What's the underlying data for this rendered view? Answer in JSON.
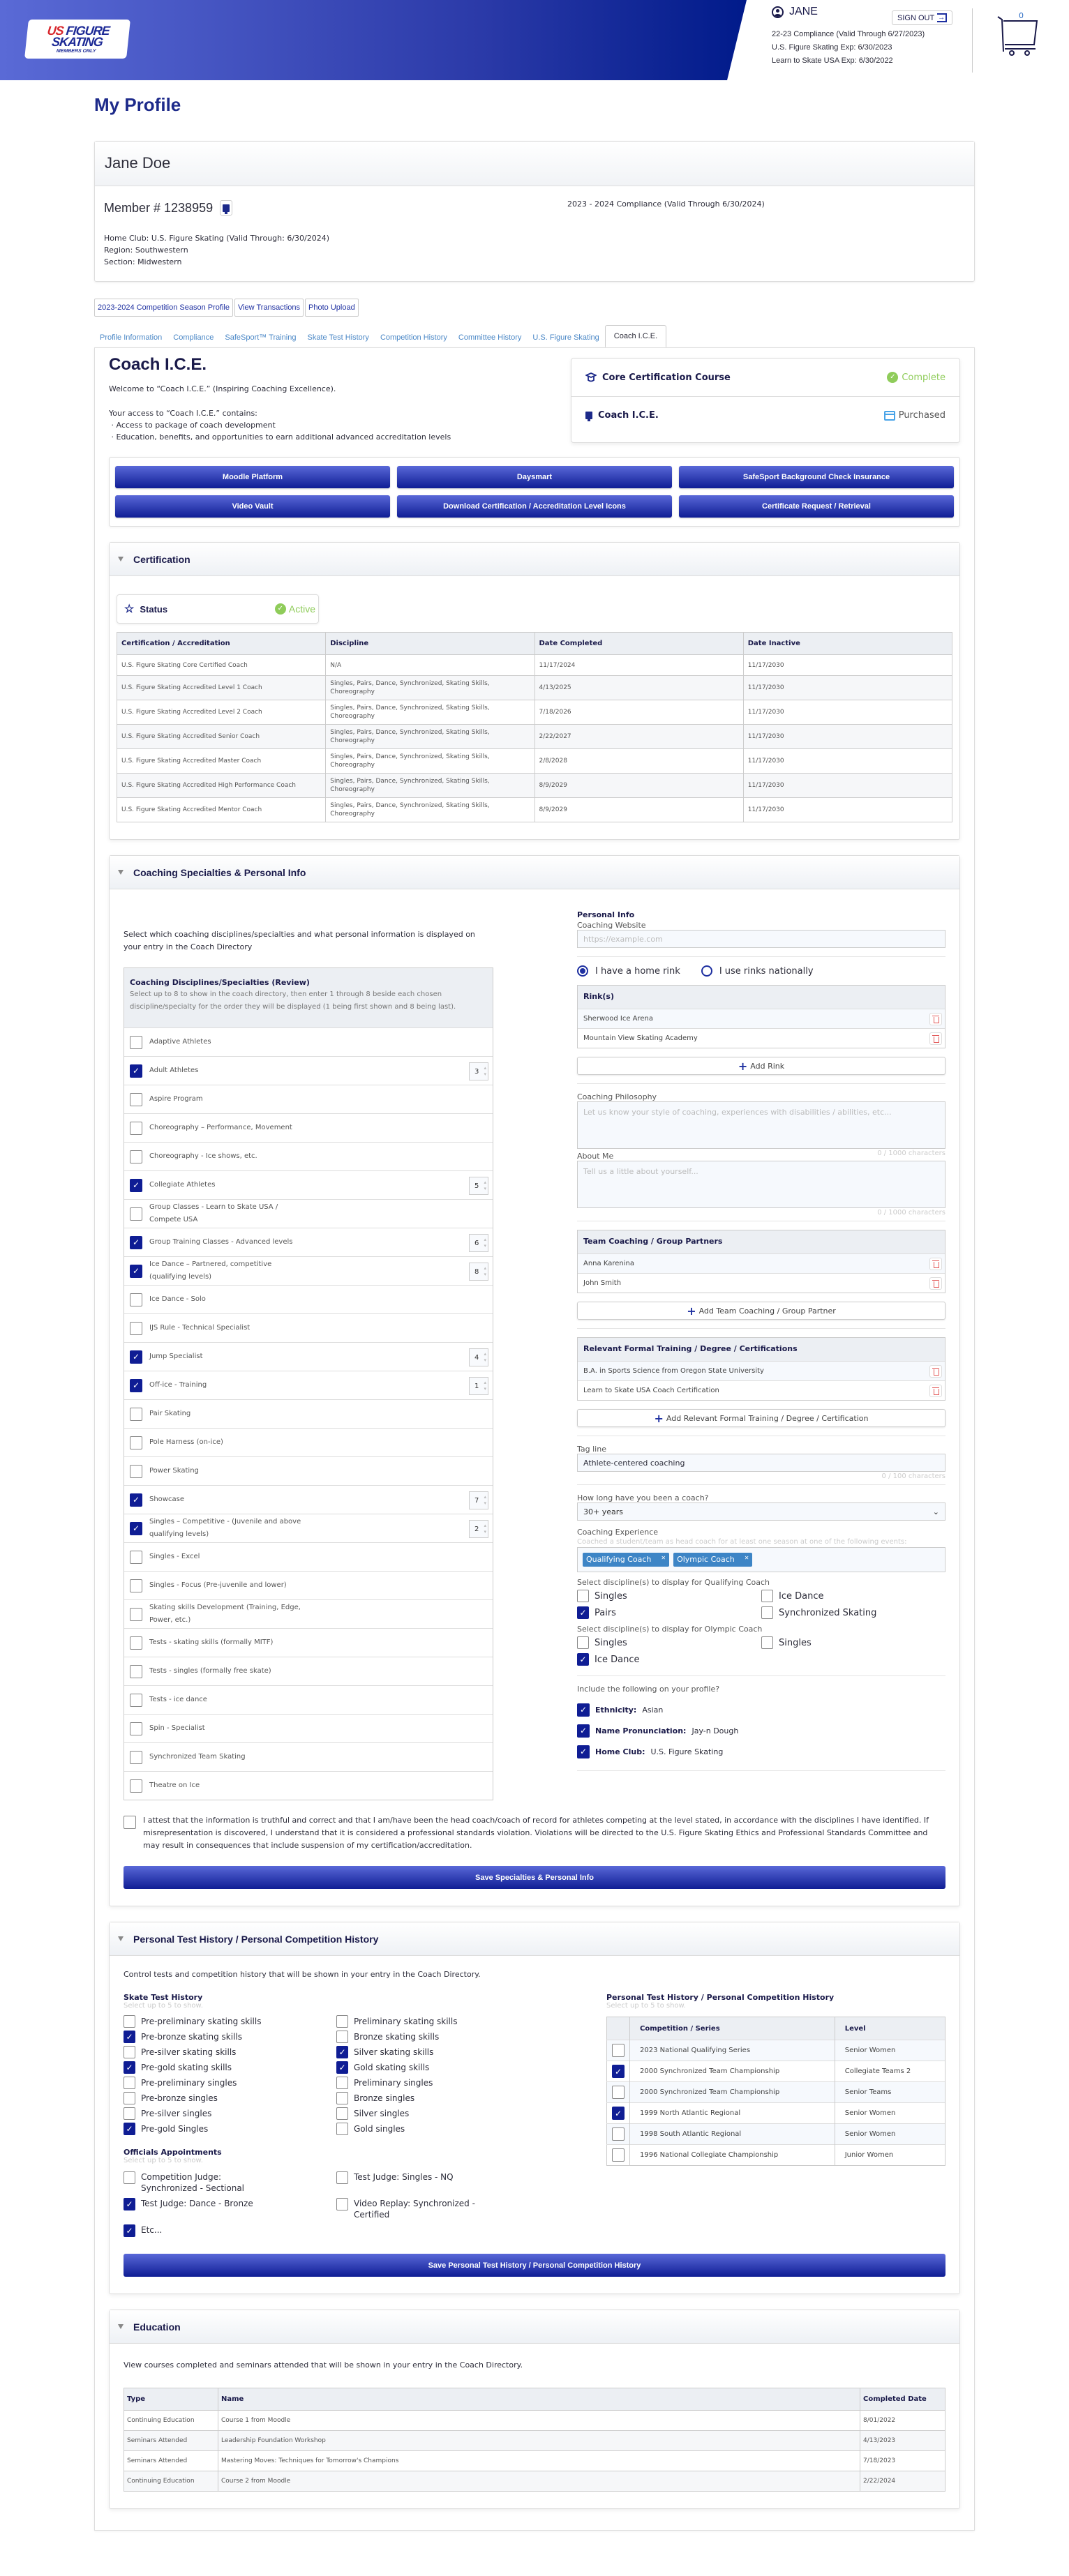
{
  "header": {
    "logo": {
      "line1a": "US",
      "line1b": "FIGURE",
      "line2": "SKATING",
      "line3": "MEMBERS ONLY"
    },
    "user_name": "JANE",
    "sign_out_label": "SIGN OUT",
    "status_lines": [
      "22-23 Compliance (Valid Through 6/27/2023)",
      "U.S. Figure Skating Exp: 6/30/2023",
      "Learn to Skate USA Exp: 6/30/2022"
    ],
    "cart_count": "0"
  },
  "page_title": "My Profile",
  "profile": {
    "name": "Jane Doe",
    "member_number": "Member # 1238959",
    "compliance": "2023 - 2024 Compliance (Valid Through 6/30/2024)",
    "home_club": "Home Club: U.S. Figure Skating (Valid Through: 6/30/2024)",
    "region": "Region:  Southwestern",
    "section": "Section:  Midwestern"
  },
  "link_buttons": [
    "2023-2024 Competition Season Profile",
    "View Transactions",
    "Photo Upload"
  ],
  "tabs": [
    {
      "label": "Profile Information",
      "active": false
    },
    {
      "label": "Compliance",
      "active": false
    },
    {
      "label": "SafeSport™ Training",
      "active": false
    },
    {
      "label": "Skate Test History",
      "active": false
    },
    {
      "label": "Competition History",
      "active": false
    },
    {
      "label": "Committee History",
      "active": false
    },
    {
      "label": "U.S. Figure Skating",
      "active": false
    },
    {
      "label": "Coach I.C.E.",
      "active": true
    }
  ],
  "coach_ice": {
    "title": "Coach I.C.E.",
    "welcome": "Welcome to “Coach I.C.E.” (Inspiring Coaching Excellence).",
    "access_intro": "Your access to “Coach I.C.E.” contains:",
    "bullets": [
      "Access to package of coach development",
      "Education, benefits, and opportunities to earn additional advanced accreditation levels"
    ],
    "status_card": [
      {
        "label": "Core Certification Course",
        "status": "Complete",
        "icon": "graduation-cap-icon"
      },
      {
        "label": "Coach I.C.E.",
        "status": "Purchased",
        "icon": "certificate-icon"
      }
    ],
    "buttons": [
      "Moodle Platform",
      "Daysmart",
      "SafeSport Background Check Insurance",
      "Video Vault",
      "Download Certification / Accreditation Level Icons",
      "Certificate Request / Retrieval"
    ]
  },
  "certification": {
    "title": "Certification",
    "status_label": "Status",
    "status_value": "Active",
    "columns": [
      "Certification / Accreditation",
      "Discipline",
      "Date Completed",
      "Date Inactive"
    ],
    "rows": [
      [
        "U.S. Figure Skating Core Certified Coach",
        "N/A",
        "11/17/2024",
        "11/17/2030"
      ],
      [
        "U.S. Figure Skating Accredited Level 1 Coach",
        "Singles, Pairs, Dance, Synchronized, Skating Skills, Choreography",
        "4/13/2025",
        "11/17/2030"
      ],
      [
        "U.S. Figure Skating Accredited Level 2 Coach",
        "Singles, Pairs, Dance, Synchronized, Skating Skills, Choreography",
        "7/18/2026",
        "11/17/2030"
      ],
      [
        "U.S. Figure Skating Accredited Senior Coach",
        "Singles, Pairs, Dance, Synchronized, Skating Skills, Choreography",
        "2/22/2027",
        "11/17/2030"
      ],
      [
        "U.S. Figure Skating Accredited Master Coach",
        "Singles, Pairs, Dance, Synchronized, Skating Skills, Choreography",
        "2/8/2028",
        "11/17/2030"
      ],
      [
        "U.S. Figure Skating Accredited High Performance Coach",
        "Singles, Pairs, Dance, Synchronized, Skating Skills, Choreography",
        "8/9/2029",
        "11/17/2030"
      ],
      [
        "U.S. Figure Skating Accredited Mentor Coach",
        "Singles, Pairs, Dance, Synchronized, Skating Skills, Choreography",
        "8/9/2029",
        "11/17/2030"
      ]
    ]
  },
  "specialties": {
    "title": "Coaching Specialties & Personal Info",
    "intro": "Select which coaching disciplines/specialties and what personal information is displayed on your entry in the Coach Directory",
    "disc_title": "Coaching Disciplines/Specialties (Review)",
    "disc_hint": "Select up to 8 to show in the coach directory, then enter 1 through 8 beside each chosen discipline/specialty for the order they will be displayed (1 being first shown and 8 being last).",
    "items": [
      {
        "label": "Adaptive Athletes",
        "checked": false,
        "order": ""
      },
      {
        "label": "Adult Athletes",
        "checked": true,
        "order": "3"
      },
      {
        "label": "Aspire Program",
        "checked": false,
        "order": ""
      },
      {
        "label": "Choreography – Performance, Movement",
        "checked": false,
        "order": ""
      },
      {
        "label": "Choreography - Ice shows, etc.",
        "checked": false,
        "order": ""
      },
      {
        "label": "Collegiate Athletes",
        "checked": true,
        "order": "5"
      },
      {
        "label": "Group Classes - Learn to Skate USA / Compete USA",
        "checked": false,
        "order": ""
      },
      {
        "label": "Group Training Classes - Advanced levels",
        "checked": true,
        "order": "6"
      },
      {
        "label": "Ice Dance – Partnered, competitive (qualifying levels)",
        "checked": true,
        "order": "8"
      },
      {
        "label": "Ice Dance - Solo",
        "checked": false,
        "order": ""
      },
      {
        "label": "IJS Rule - Technical Specialist",
        "checked": false,
        "order": ""
      },
      {
        "label": "Jump Specialist",
        "checked": true,
        "order": "4"
      },
      {
        "label": "Off-ice - Training",
        "checked": true,
        "order": "1"
      },
      {
        "label": "Pair Skating",
        "checked": false,
        "order": ""
      },
      {
        "label": "Pole Harness (on-ice)",
        "checked": false,
        "order": ""
      },
      {
        "label": "Power Skating",
        "checked": false,
        "order": ""
      },
      {
        "label": "Showcase",
        "checked": true,
        "order": "7"
      },
      {
        "label": "Singles – Competitive - (Juvenile and above qualifying levels)",
        "checked": true,
        "order": "2"
      },
      {
        "label": "Singles - Excel",
        "checked": false,
        "order": ""
      },
      {
        "label": "Singles - Focus (Pre-juvenile and lower)",
        "checked": false,
        "order": ""
      },
      {
        "label": "Skating skills Development (Training, Edge, Power, etc.)",
        "checked": false,
        "order": ""
      },
      {
        "label": "Tests - skating skills (formally MITF)",
        "checked": false,
        "order": ""
      },
      {
        "label": "Tests - singles (formally free skate)",
        "checked": false,
        "order": ""
      },
      {
        "label": "Tests - ice dance",
        "checked": false,
        "order": ""
      },
      {
        "label": "Spin - Specialist",
        "checked": false,
        "order": ""
      },
      {
        "label": "Synchronized Team Skating",
        "checked": false,
        "order": ""
      },
      {
        "label": "Theatre on Ice",
        "checked": false,
        "order": ""
      }
    ],
    "personal": {
      "title": "Personal Info",
      "website_label": "Coaching Website",
      "website_placeholder": "https://example.com",
      "radio_home": "I have a home rink",
      "radio_national": "I use rinks nationally",
      "rinks_title": "Rink(s)",
      "rinks": [
        "Sherwood Ice Arena",
        "Mountain View Skating Academy"
      ],
      "add_rink": "Add Rink",
      "philosophy_label": "Coaching Philosophy",
      "philosophy_placeholder": "Let us know your style of coaching, experiences with disabilities / abilities, etc...",
      "philosophy_counter": "0 / 1000 characters",
      "about_label": "About Me",
      "about_placeholder": "Tell us a little about yourself...",
      "about_counter": "0 / 1000 characters",
      "partners_title": "Team Coaching / Group Partners",
      "partners": [
        "Anna Karenina",
        "John Smith"
      ],
      "add_partner": "Add Team Coaching / Group Partner",
      "training_title": "Relevant Formal Training / Degree / Certifications",
      "training": [
        "B.A. in Sports Science from Oregon State University",
        "Learn to Skate USA Coach Certification"
      ],
      "add_training": "Add Relevant Formal Training / Degree / Certification",
      "tagline_label": "Tag line",
      "tagline_value": "Athlete-centered coaching",
      "tagline_counter": "0 / 100 characters",
      "years_label": "How long have you been a coach?",
      "years_value": "30+ years",
      "experience_label": "Coaching Experience",
      "experience_hint": "Coached a student/team as head coach for at least one season at one of the following events:",
      "experience_tags": [
        "Qualifying Coach",
        "Olympic Coach"
      ],
      "qual_label": "Select discipline(s) to display for Qualifying Coach",
      "qual_options": [
        {
          "label": "Singles",
          "checked": false
        },
        {
          "label": "Ice Dance",
          "checked": false
        },
        {
          "label": "Pairs",
          "checked": true
        },
        {
          "label": "Synchronized Skating",
          "checked": false
        }
      ],
      "olympic_label": "Select discipline(s) to display for Olympic Coach",
      "olympic_options": [
        {
          "label": "Singles",
          "checked": false
        },
        {
          "label": "Singles",
          "checked": false
        },
        {
          "label": "Ice Dance",
          "checked": true
        }
      ],
      "include_label": "Include the following on your profile?",
      "include": [
        {
          "key": "Ethnicity:",
          "value": "Asian",
          "checked": true
        },
        {
          "key": "Name Pronunciation:",
          "value": "Jay-n Dough",
          "checked": true
        },
        {
          "key": "Home Club:",
          "value": "U.S. Figure Skating",
          "checked": true
        }
      ]
    },
    "attest": "I attest that the information is truthful and correct and that I am/have been the head coach/coach of record for athletes competing at the level stated, in accordance with the disciplines I have identified. If misrepresentation is discovered, I understand that it is considered a professional standards violation. Violations will be directed to the U.S. Figure Skating Ethics and Professional Standards Committee and may result in consequences that include suspension of my certification/accreditation.",
    "save_label": "Save Specialties & Personal Info"
  },
  "history": {
    "title": "Personal Test History / Personal Competition History",
    "intro": "Control tests and competition history that will be shown in your entry in the Coach Directory.",
    "skate_title": "Skate Test History",
    "skate_hint": "Select up to 5 to show.",
    "skate_left": [
      {
        "label": "Pre-preliminary skating skills",
        "checked": false
      },
      {
        "label": "Pre-bronze skating skills",
        "checked": true
      },
      {
        "label": "Pre-silver skating skills",
        "checked": false
      },
      {
        "label": "Pre-gold skating skills",
        "checked": true
      },
      {
        "label": "Pre-preliminary singles",
        "checked": false
      },
      {
        "label": "Pre-bronze singles",
        "checked": false
      },
      {
        "label": "Pre-silver singles",
        "checked": false
      },
      {
        "label": "Pre-gold Singles",
        "checked": true
      }
    ],
    "skate_right": [
      {
        "label": "Preliminary skating skills",
        "checked": false
      },
      {
        "label": "Bronze skating skills",
        "checked": false
      },
      {
        "label": "Silver skating skills",
        "checked": true
      },
      {
        "label": "Gold skating skills",
        "checked": true
      },
      {
        "label": "Preliminary singles",
        "checked": false
      },
      {
        "label": "Bronze singles",
        "checked": false
      },
      {
        "label": "Silver singles",
        "checked": false
      },
      {
        "label": "Gold singles",
        "checked": false
      }
    ],
    "officials_title": "Officials Appointments",
    "officials_hint": "Select up to 5 to show.",
    "officials": [
      {
        "label": "Competition Judge: Synchronized - Sectional",
        "checked": false
      },
      {
        "label": "Test Judge: Singles - NQ",
        "checked": false
      },
      {
        "label": "Test Judge: Dance - Bronze",
        "checked": true
      },
      {
        "label": "Video Replay: Synchronized - Certified",
        "checked": false
      },
      {
        "label": "Etc...",
        "checked": true
      }
    ],
    "comp_title": "Personal Test History / Personal Competition History",
    "comp_hint": "Select up to 5 to show.",
    "comp_columns": [
      "Competition / Series",
      "Level"
    ],
    "comp_rows": [
      {
        "name": "2023 National Qualifying Series",
        "level": "Senior Women",
        "checked": false
      },
      {
        "name": "2000 Synchronized Team Championship",
        "level": "Collegiate Teams 2",
        "checked": true
      },
      {
        "name": "2000 Synchronized Team Championship",
        "level": "Senior Teams",
        "checked": false
      },
      {
        "name": "1999 North Atlantic Regional",
        "level": "Senior Women",
        "checked": true
      },
      {
        "name": "1998 South Atlantic Regional",
        "level": "Senior Women",
        "checked": false
      },
      {
        "name": "1996 National Collegiate Championship",
        "level": "Junior Women",
        "checked": false
      }
    ],
    "save_label": "Save Personal Test History / Personal Competition History"
  },
  "education": {
    "title": "Education",
    "intro": "View courses completed and seminars attended that will be shown in your entry in the Coach Directory.",
    "columns": [
      "Type",
      "Name",
      "Completed Date"
    ],
    "rows": [
      [
        "Continuing Education",
        "Course 1 from Moodle",
        "8/01/2022"
      ],
      [
        "Seminars Attended",
        "Leadership Foundation Workshop",
        "4/13/2023"
      ],
      [
        "Seminars Attended",
        "Mastering Moves: Techniques for Tomorrow's Champions",
        "7/18/2023"
      ],
      [
        "Continuing Education",
        "Course 2 from Moodle",
        "2/22/2024"
      ]
    ]
  }
}
